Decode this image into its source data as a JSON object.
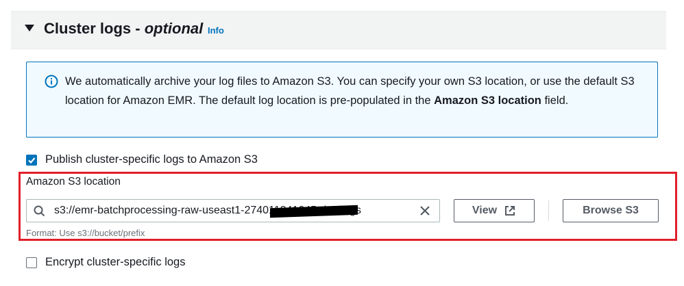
{
  "section": {
    "title_main": "Cluster logs - ",
    "title_emphasis": "optional",
    "info_link": "Info"
  },
  "alert": {
    "text_before_bold": "We automatically archive your log files to Amazon S3. You can specify your own S3 location, or use the default S3 location for Amazon EMR. The default log location is pre-populated in the ",
    "text_bold": "Amazon S3 location",
    "text_after_bold": " field."
  },
  "publish_logs": {
    "label": "Publish cluster-specific logs to Amazon S3",
    "checked": true
  },
  "s3_location": {
    "label": "Amazon S3 location",
    "value": "s3://emr-batchprocessing-raw-useast1-274011241045-dev/logs",
    "hint": "Format: Use s3://bucket/prefix",
    "view_button": "View",
    "browse_button": "Browse S3"
  },
  "encrypt_logs": {
    "label": "Encrypt cluster-specific logs",
    "checked": false
  },
  "colors": {
    "accent": "#0073bb",
    "highlight_border": "#e01e2a",
    "alert_background": "#f1faff"
  },
  "icons": {
    "expand": "caret-down-icon",
    "alert": "info-circle-icon",
    "search": "search-icon",
    "clear": "close-icon",
    "external": "external-link-icon",
    "checkbox": "checkmark-icon"
  }
}
